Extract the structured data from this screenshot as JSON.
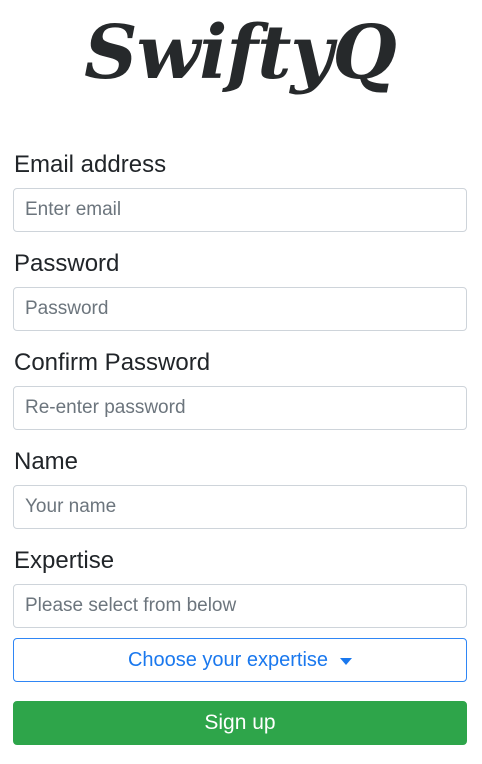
{
  "app": {
    "logo_text": "SwiftyQ"
  },
  "form": {
    "email": {
      "label": "Email address",
      "placeholder": "Enter email",
      "value": ""
    },
    "password": {
      "label": "Password",
      "placeholder": "Password",
      "value": ""
    },
    "confirm_password": {
      "label": "Confirm Password",
      "placeholder": "Re-enter password",
      "value": ""
    },
    "name": {
      "label": "Name",
      "placeholder": "Your name",
      "value": ""
    },
    "expertise": {
      "label": "Expertise",
      "placeholder": "Please select from below",
      "value": "",
      "dropdown_label": "Choose your expertise",
      "dropdown_icon": "caret-down-icon"
    },
    "submit_label": "Sign up"
  },
  "colors": {
    "brand_text": "#26292b",
    "input_border": "#ced4da",
    "placeholder": "#6c757d",
    "dropdown_accent": "#1a78ee",
    "signup_green": "#2ea54a"
  }
}
